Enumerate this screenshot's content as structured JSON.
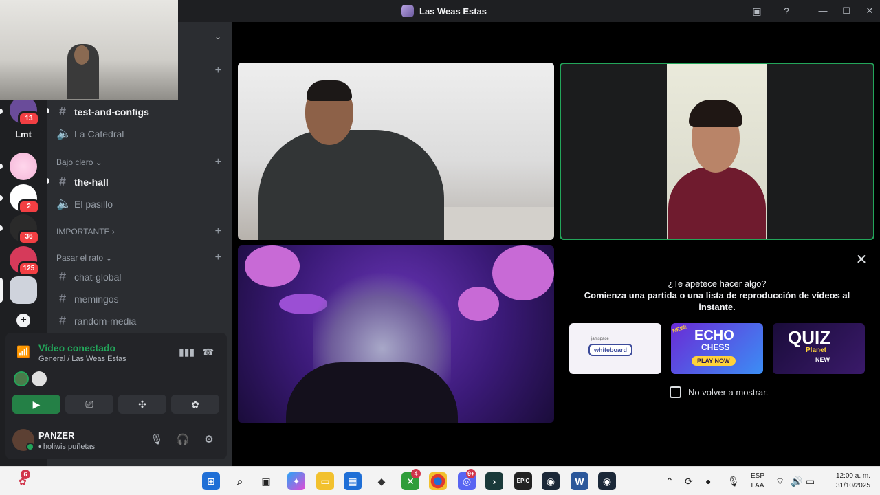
{
  "window": {
    "title": "Las Weas Estas"
  },
  "rail": {
    "servers": [
      {
        "name": "server-1",
        "badge": "13",
        "color": "#6a4c9a"
      },
      {
        "name": "server-lmt",
        "text": "Lmt"
      },
      {
        "name": "server-3",
        "badge": "",
        "color": "#f4b6d8"
      },
      {
        "name": "server-4",
        "badge": "2",
        "color": "#ffffff"
      },
      {
        "name": "server-5",
        "badge": "36",
        "color": "#2a2a2a"
      },
      {
        "name": "server-6",
        "badge": "125",
        "color": "#d63a5a"
      },
      {
        "name": "server-7",
        "badge": "",
        "color": "#cfd3dc"
      }
    ]
  },
  "sidebar": {
    "channels_top": [
      {
        "name": "test-and-configs",
        "type": "text",
        "unread": true
      },
      {
        "name": "La Catedral",
        "type": "voice",
        "unread": false
      }
    ],
    "categories": [
      {
        "label": "Bajo clero",
        "channels": [
          {
            "name": "the-hall",
            "type": "text",
            "unread": true
          },
          {
            "name": "El pasillo",
            "type": "voice",
            "unread": false
          }
        ]
      },
      {
        "label": "IMPORTANTE",
        "channels": []
      },
      {
        "label": "Pasar el rato",
        "channels": [
          {
            "name": "chat-global",
            "type": "text",
            "unread": false
          },
          {
            "name": "memingos",
            "type": "text",
            "unread": false
          },
          {
            "name": "random-media",
            "type": "text",
            "unread": false
          }
        ]
      }
    ]
  },
  "voice": {
    "status": "Vídeo conectado",
    "location": "General / Las Weas Estas"
  },
  "user": {
    "name": "PANZER",
    "status": "• holiwis puñetas"
  },
  "activity": {
    "title_line1": "¿Te apetece hacer algo?",
    "title_line2": "Comienza una partida o una lista de reproducción de vídeos al instante.",
    "cards": [
      {
        "label": "whiteboard",
        "small": "jamspace"
      },
      {
        "label": "ECHO",
        "sub": "CHESS",
        "cta": "PLAY NOW",
        "tag": "NEW!"
      },
      {
        "label": "QUIZ",
        "sub": "Planet",
        "tag": "NEW"
      }
    ],
    "dont_show": "No volver a mostrar."
  },
  "taskbar": {
    "lang1": "ESP",
    "lang2": "LAA",
    "time": "12:00 a. m.",
    "date": "31/10/2025",
    "notif_badge": "6",
    "discord_badge": "9+",
    "xbox_badge": "4"
  },
  "colors": {
    "accent_green": "#23a55a",
    "background": "#1e1f22",
    "sidebar": "#2b2d31"
  }
}
